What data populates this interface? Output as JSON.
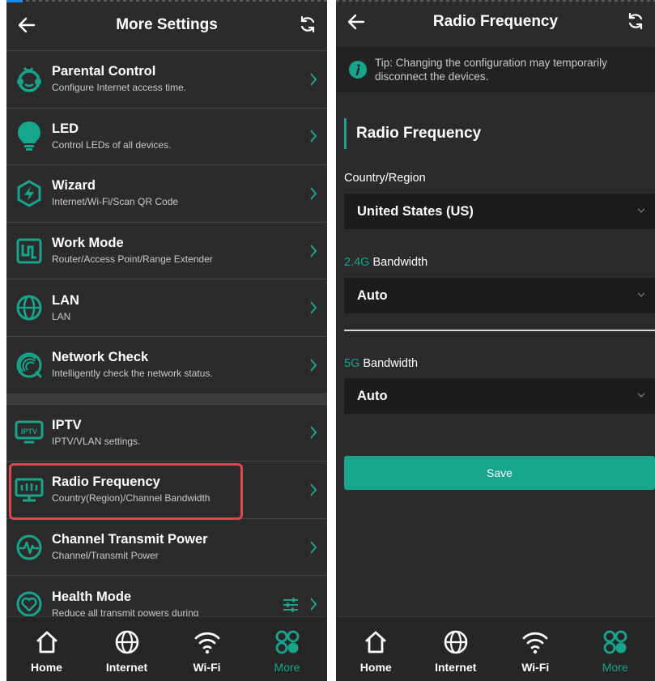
{
  "colors": {
    "accent": "#17a58c",
    "highlight": "#e0474c",
    "background": "#2b2b2b"
  },
  "left": {
    "header": {
      "title": "More Settings",
      "back_icon": "arrow-left-icon",
      "refresh_icon": "refresh-icon"
    },
    "items": [
      {
        "title": "Parental Control",
        "subtitle": "Configure Internet access time.",
        "icon": "child-face-icon"
      },
      {
        "title": "LED",
        "subtitle": "Control LEDs of all devices.",
        "icon": "bulb-icon"
      },
      {
        "title": "Wizard",
        "subtitle": "Internet/Wi-Fi/Scan QR Code",
        "icon": "lightning-hexagon-icon"
      },
      {
        "title": "Work Mode",
        "subtitle": "Router/Access Point/Range Extender",
        "icon": "work-mode-icon"
      },
      {
        "title": "LAN",
        "subtitle": "LAN",
        "icon": "globe-icon"
      },
      {
        "title": "Network Check",
        "subtitle": "Intelligently check the network status.",
        "icon": "network-check-icon"
      },
      {
        "title": "IPTV",
        "subtitle": "IPTV/VLAN settings.",
        "icon": "iptv-icon",
        "icon_text": "IPTV"
      },
      {
        "title": "Radio Frequency",
        "subtitle": "Country(Region)/Channel Bandwidth",
        "icon": "radio-frequency-icon"
      },
      {
        "title": "Channel Transmit Power",
        "subtitle": "Channel/Transmit Power",
        "icon": "pulse-icon"
      },
      {
        "title": "Health Mode",
        "subtitle": "Reduce all transmit powers during",
        "icon": "heart-icon"
      }
    ]
  },
  "right": {
    "header": {
      "title": "Radio Frequency"
    },
    "tip": "Tip: Changing the configuration may temporarily disconnect the devices.",
    "section_title": "Radio Frequency",
    "country_label": "Country/Region",
    "country_value": "United States (US)",
    "bw24_prefix": "2.4G",
    "bw24_label": " Bandwidth",
    "bw24_value": "Auto",
    "bw5_prefix": "5G",
    "bw5_label": " Bandwidth",
    "bw5_value": "Auto",
    "save_label": "Save"
  },
  "nav": [
    {
      "label": "Home",
      "icon": "home-icon"
    },
    {
      "label": "Internet",
      "icon": "globe-icon"
    },
    {
      "label": "Wi-Fi",
      "icon": "wifi-icon"
    },
    {
      "label": "More",
      "icon": "more-grid-icon",
      "active": true
    }
  ]
}
